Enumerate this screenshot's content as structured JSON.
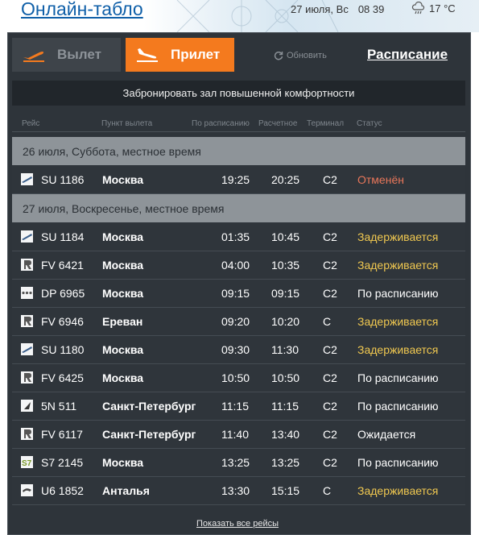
{
  "header": {
    "title": "Онлайн-табло",
    "date": "27 июля, Вс",
    "time": "08 39",
    "weather_icon": "cloud-rain-icon",
    "temperature": "17 °C"
  },
  "tabs": {
    "departure_label": "Вылет",
    "arrival_label": "Прилет",
    "refresh_label": "Обновить",
    "schedule_label": "Расписание"
  },
  "booking_label": "Забронировать зал повышенной комфортности",
  "columns": {
    "flight": "Рейс",
    "origin": "Пункт вылета",
    "scheduled": "По расписанию",
    "estimated": "Расчетное",
    "terminal": "Терминал",
    "status": "Статус"
  },
  "groups": [
    {
      "date_label": "26 июля, Суббота, местное время",
      "flights": [
        {
          "airline": "aeroflot",
          "number": "SU 1186",
          "city": "Москва",
          "scheduled": "19:25",
          "estimated": "20:25",
          "terminal": "C2",
          "status": "Отменён",
          "status_color": "#e8765a"
        }
      ]
    },
    {
      "date_label": "27 июля, Воскресенье, местное время",
      "flights": [
        {
          "airline": "aeroflot",
          "number": "SU 1184",
          "city": "Москва",
          "scheduled": "01:35",
          "estimated": "10:45",
          "terminal": "C2",
          "status": "Задерживается",
          "status_color": "#f0c850"
        },
        {
          "airline": "pobeda",
          "number": "FV 6421",
          "city": "Москва",
          "scheduled": "04:00",
          "estimated": "10:35",
          "terminal": "C2",
          "status": "Задерживается",
          "status_color": "#f0c850"
        },
        {
          "airline": "pobeda-dp",
          "number": "DP 6965",
          "city": "Москва",
          "scheduled": "09:15",
          "estimated": "09:15",
          "terminal": "C2",
          "status": "По расписанию",
          "status_color": "#ffffff"
        },
        {
          "airline": "pobeda",
          "number": "FV 6946",
          "city": "Ереван",
          "scheduled": "09:20",
          "estimated": "10:20",
          "terminal": "C",
          "status": "Задерживается",
          "status_color": "#f0c850"
        },
        {
          "airline": "aeroflot",
          "number": "SU 1180",
          "city": "Москва",
          "scheduled": "09:30",
          "estimated": "11:30",
          "terminal": "C2",
          "status": "Задерживается",
          "status_color": "#f0c850"
        },
        {
          "airline": "pobeda",
          "number": "FV 6425",
          "city": "Москва",
          "scheduled": "10:50",
          "estimated": "10:50",
          "terminal": "C2",
          "status": "По расписанию",
          "status_color": "#ffffff"
        },
        {
          "airline": "smartavia",
          "number": "5N 511",
          "city": "Санкт-Петербург",
          "scheduled": "11:15",
          "estimated": "11:15",
          "terminal": "C2",
          "status": "По расписанию",
          "status_color": "#ffffff"
        },
        {
          "airline": "pobeda",
          "number": "FV 6117",
          "city": "Санкт-Петербург",
          "scheduled": "11:40",
          "estimated": "13:40",
          "terminal": "C2",
          "status": "Ожидается",
          "status_color": "#ffffff"
        },
        {
          "airline": "s7",
          "number": "S7 2145",
          "city": "Москва",
          "scheduled": "13:25",
          "estimated": "13:25",
          "terminal": "C2",
          "status": "По расписанию",
          "status_color": "#ffffff"
        },
        {
          "airline": "uralairlines",
          "number": "U6 1852",
          "city": "Анталья",
          "scheduled": "13:30",
          "estimated": "15:15",
          "terminal": "C",
          "status": "Задерживается",
          "status_color": "#f0c850"
        }
      ]
    }
  ],
  "show_all_label": "Показать все рейсы",
  "colors": {
    "accent": "#f47a1e",
    "board_bg": "#2e343a",
    "delayed": "#f0c850",
    "cancelled": "#e8765a",
    "title_link": "#0f5fa8"
  }
}
